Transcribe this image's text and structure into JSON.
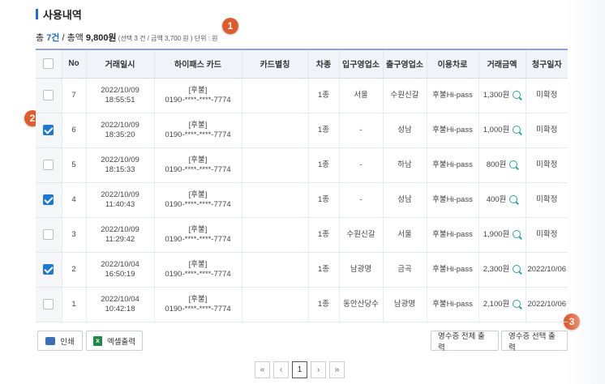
{
  "section": {
    "title": "사용내역"
  },
  "summary": {
    "prefix": "총 ",
    "count": "7건",
    "sep": " / 총액 ",
    "amount": "9,800원",
    "selected": " (선택 3 건 / 금액 3,700 원 )",
    "unit": " 단위 : 원"
  },
  "markers": [
    "1",
    "2",
    "3"
  ],
  "table": {
    "headers": [
      "No",
      "거래일시",
      "하이패스 카드",
      "카드별칭",
      "차종",
      "입구영업소",
      "출구영업소",
      "이용차로",
      "거래금액",
      "청구일자"
    ],
    "rows": [
      {
        "checked": false,
        "no": "7",
        "date": "2022/10/09",
        "time": "18:55:51",
        "card_type": "[후불]",
        "card_no": "0190-****-****-7774",
        "alias": "",
        "car": "1종",
        "entry": "서울",
        "exit": "수원신갈",
        "lane": "후불Hi-pass",
        "amount": "1,300원",
        "billing": "미확정"
      },
      {
        "checked": true,
        "no": "6",
        "date": "2022/10/09",
        "time": "18:35:20",
        "card_type": "[후불]",
        "card_no": "0190-****-****-7774",
        "alias": "",
        "car": "1종",
        "entry": "-",
        "exit": "성남",
        "lane": "후불Hi-pass",
        "amount": "1,000원",
        "billing": "미확정"
      },
      {
        "checked": false,
        "no": "5",
        "date": "2022/10/09",
        "time": "18:15:33",
        "card_type": "[후불]",
        "card_no": "0190-****-****-7774",
        "alias": "",
        "car": "1종",
        "entry": "-",
        "exit": "하남",
        "lane": "후불Hi-pass",
        "amount": "800원",
        "billing": "미확정"
      },
      {
        "checked": true,
        "no": "4",
        "date": "2022/10/09",
        "time": "11:40:43",
        "card_type": "[후불]",
        "card_no": "0190-****-****-7774",
        "alias": "",
        "car": "1종",
        "entry": "-",
        "exit": "성남",
        "lane": "후불Hi-pass",
        "amount": "400원",
        "billing": "미확정"
      },
      {
        "checked": false,
        "no": "3",
        "date": "2022/10/09",
        "time": "11:29:42",
        "card_type": "[후불]",
        "card_no": "0190-****-****-7774",
        "alias": "",
        "car": "1종",
        "entry": "수원신갈",
        "exit": "서울",
        "lane": "후불Hi-pass",
        "amount": "1,900원",
        "billing": "미확정"
      },
      {
        "checked": true,
        "no": "2",
        "date": "2022/10/04",
        "time": "16:50:19",
        "card_type": "[후불]",
        "card_no": "0190-****-****-7774",
        "alias": "",
        "car": "1종",
        "entry": "남광명",
        "exit": "금곡",
        "lane": "후불Hi-pass",
        "amount": "2,300원",
        "billing": "2022/10/06"
      },
      {
        "checked": false,
        "no": "1",
        "date": "2022/10/04",
        "time": "10:42:18",
        "card_type": "[후불]",
        "card_no": "0190-****-****-7774",
        "alias": "",
        "car": "1종",
        "entry": "동안산당수",
        "exit": "남광명",
        "lane": "후불Hi-pass",
        "amount": "2,100원",
        "billing": "2022/10/06"
      }
    ]
  },
  "buttons": {
    "print": "인쇄",
    "excel": "엑셀출력",
    "receipt_all": "영수증 전체 출력",
    "receipt_selected": "영수증 선택 출력"
  },
  "pager": {
    "first": "«",
    "prev": "‹",
    "current": "1",
    "next": "›",
    "last": "»"
  },
  "colors": {
    "accent": "#1f6fd0",
    "checkbox_on": "#1f78d1",
    "marker": "#e05a2b",
    "zoom": "#2fa0a0"
  }
}
